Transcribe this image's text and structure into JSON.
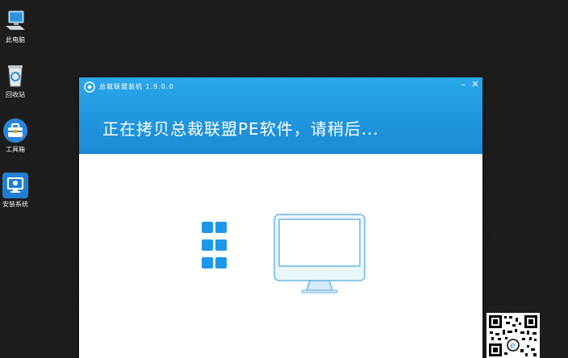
{
  "desktop": {
    "icons": [
      {
        "label": "此电脑",
        "icon": "computer-icon"
      },
      {
        "label": "回收站",
        "icon": "recycle-bin-icon"
      },
      {
        "label": "工具箱",
        "icon": "toolbox-icon"
      },
      {
        "label": "安装系统",
        "icon": "install-system-icon"
      }
    ]
  },
  "window": {
    "title": "总裁联盟装机 1.9.0.0",
    "status_message": "正在拷贝总裁联盟PE软件，请稍后...",
    "minimize_label": "–",
    "close_label": "✕",
    "accent_color": "#2196df",
    "icon_color": "#1d97ec",
    "graphics": [
      "windows-logo-icon",
      "monitor-icon"
    ]
  },
  "overlay": {
    "qr_code": "qr-code"
  }
}
